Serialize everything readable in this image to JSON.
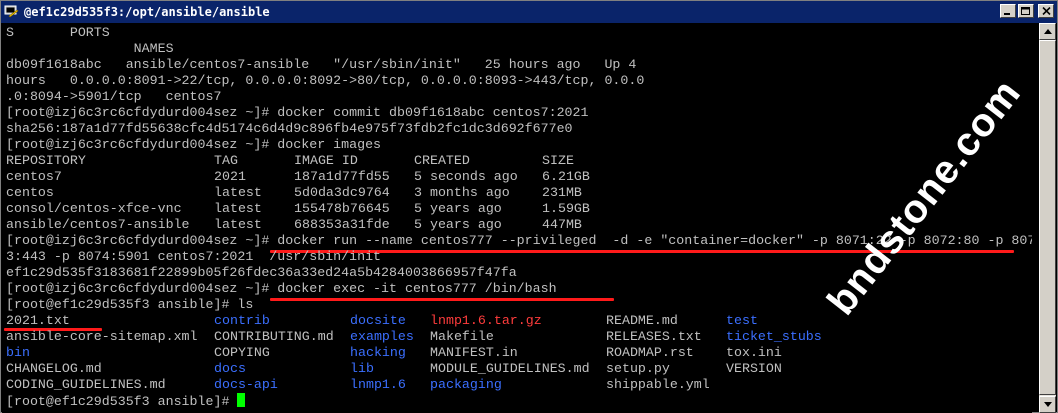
{
  "window": {
    "title": "@ef1c29d535f3:/opt/ansible/ansible"
  },
  "terminal": {
    "l0": "S       PORTS",
    "l1": "                NAMES",
    "l2": "db09f1618abc   ansible/centos7-ansible   \"/usr/sbin/init\"   25 hours ago   Up 4",
    "l3": "hours   0.0.0.0:8091->22/tcp, 0.0.0.0:8092->80/tcp, 0.0.0.0:8093->443/tcp, 0.0.0",
    "l4": ".0:8094->5901/tcp   centos7",
    "l5": "[root@izj6c3rc6cfdydurd004sez ~]# docker commit db09f1618abc centos7:2021",
    "l6": "sha256:187a1d77fd55638cfc4d5174c6d4d9c896fb4e975f73fdb2fc1dc3d692f677e0",
    "l7": "[root@izj6c3rc6cfdydurd004sez ~]# docker images",
    "images_header": [
      "REPOSITORY",
      "TAG",
      "IMAGE ID",
      "CREATED",
      "SIZE"
    ],
    "images": [
      [
        "centos7",
        "2021",
        "187a1d77fd55",
        "5 seconds ago",
        "6.21GB"
      ],
      [
        "centos",
        "latest",
        "5d0da3dc9764",
        "3 months ago",
        "231MB"
      ],
      [
        "consol/centos-xfce-vnc",
        "latest",
        "155478b76645",
        "5 years ago",
        "1.59GB"
      ],
      [
        "ansible/centos7-ansible",
        "latest",
        "688353a31fde",
        "5 years ago",
        "447MB"
      ]
    ],
    "l13": "[root@izj6c3rc6cfdydurd004sez ~]# docker run --name centos777 --privileged  -d -e \"container=docker\" -p 8071:22 -p 8072:80 -p 807",
    "l14": "3:443 -p 8074:5901 centos7:2021  /usr/sbin/init",
    "l15": "ef1c29d535f3183681f22899b05f26fdec36a33ed24a5b4284003866957f47fa",
    "l16": "[root@izj6c3rc6cfdydurd004sez ~]# docker exec -it centos777 /bin/bash",
    "l17": "[root@ef1c29d535f3 ansible]# ls",
    "ls_rows": [
      [
        {
          "t": "2021.txt",
          "c": "default"
        },
        {
          "t": "contrib",
          "c": "blue"
        },
        {
          "t": "docsite",
          "c": "blue"
        },
        {
          "t": "lnmp1.6.tar.gz",
          "c": "red"
        },
        {
          "t": "README.md",
          "c": "default"
        },
        {
          "t": "test",
          "c": "blue"
        }
      ],
      [
        {
          "t": "ansible-core-sitemap.xml",
          "c": "default"
        },
        {
          "t": "CONTRIBUTING.md",
          "c": "default"
        },
        {
          "t": "examples",
          "c": "blue"
        },
        {
          "t": "Makefile",
          "c": "default"
        },
        {
          "t": "RELEASES.txt",
          "c": "default"
        },
        {
          "t": "ticket_stubs",
          "c": "blue"
        }
      ],
      [
        {
          "t": "bin",
          "c": "blue"
        },
        {
          "t": "COPYING",
          "c": "default"
        },
        {
          "t": "hacking",
          "c": "blue"
        },
        {
          "t": "MANIFEST.in",
          "c": "default"
        },
        {
          "t": "ROADMAP.rst",
          "c": "default"
        },
        {
          "t": "tox.ini",
          "c": "default"
        }
      ],
      [
        {
          "t": "CHANGELOG.md",
          "c": "default"
        },
        {
          "t": "docs",
          "c": "blue"
        },
        {
          "t": "lib",
          "c": "blue"
        },
        {
          "t": "MODULE_GUIDELINES.md",
          "c": "default"
        },
        {
          "t": "setup.py",
          "c": "default"
        },
        {
          "t": "VERSION",
          "c": "default"
        }
      ],
      [
        {
          "t": "CODING_GUIDELINES.md",
          "c": "default"
        },
        {
          "t": "docs-api",
          "c": "blue"
        },
        {
          "t": "lnmp1.6",
          "c": "blue"
        },
        {
          "t": "packaging",
          "c": "blue"
        },
        {
          "t": "shippable.yml",
          "c": "default"
        },
        {
          "t": "",
          "c": "default"
        }
      ]
    ],
    "prompt": "[root@ef1c29d535f3 ansible]# "
  },
  "watermark": "bndstone.com",
  "colors": {
    "background": "#000000",
    "text": "#c0c0c0",
    "directory": "#3b6fff",
    "archive": "#ff3c3c",
    "cursor": "#00ff00",
    "annotation": "#ff1a1a",
    "titlebar": "#0a246a"
  }
}
